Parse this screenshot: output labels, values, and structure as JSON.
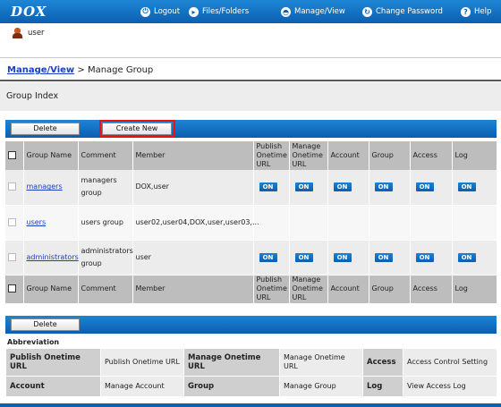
{
  "app": {
    "logo": "DOX"
  },
  "nav": [
    {
      "label": "Logout",
      "icon": "logout-icon"
    },
    {
      "label": "Files/Folders",
      "icon": "files-folders-icon"
    },
    {
      "label": "Manage/View",
      "icon": "manage-view-icon"
    },
    {
      "label": "Change Password",
      "icon": "change-password-icon"
    },
    {
      "label": "Help",
      "icon": "help-icon"
    }
  ],
  "user": {
    "name": "user"
  },
  "breadcrumb": {
    "parent": "Manage/View",
    "separator": ">",
    "current": "Manage Group"
  },
  "section": {
    "title": "Group Index"
  },
  "toolbar": {
    "delete_label": "Delete",
    "create_label": "Create New"
  },
  "table": {
    "headers": {
      "group_name": "Group Name",
      "comment": "Comment",
      "member": "Member",
      "publish": "Publish Onetime URL",
      "manage": "Manage Onetime URL",
      "account": "Account",
      "group": "Group",
      "access": "Access",
      "log": "Log"
    },
    "rows": [
      {
        "name": "managers",
        "comment": "managers group",
        "member": "DOX,user",
        "publish": "ON",
        "manage": "ON",
        "account": "ON",
        "group": "ON",
        "access": "ON",
        "log": "ON"
      },
      {
        "name": "users",
        "comment": "users group",
        "member": "user02,user04,DOX,user,user03,...",
        "publish": "",
        "manage": "",
        "account": "",
        "group": "",
        "access": "",
        "log": ""
      },
      {
        "name": "administrators",
        "comment": "administrators group",
        "member": "user",
        "publish": "ON",
        "manage": "ON",
        "account": "ON",
        "group": "ON",
        "access": "ON",
        "log": "ON"
      }
    ]
  },
  "abbreviation": {
    "title": "Abbreviation",
    "items": [
      {
        "key": "Publish Onetime URL",
        "value": "Publish Onetime URL"
      },
      {
        "key": "Manage Onetime URL",
        "value": "Manage Onetime URL"
      },
      {
        "key": "Access",
        "value": "Access Control Setting"
      },
      {
        "key": "Account",
        "value": "Manage Account"
      },
      {
        "key": "Group",
        "value": "Manage Group"
      },
      {
        "key": "Log",
        "value": "View Access Log"
      }
    ]
  }
}
